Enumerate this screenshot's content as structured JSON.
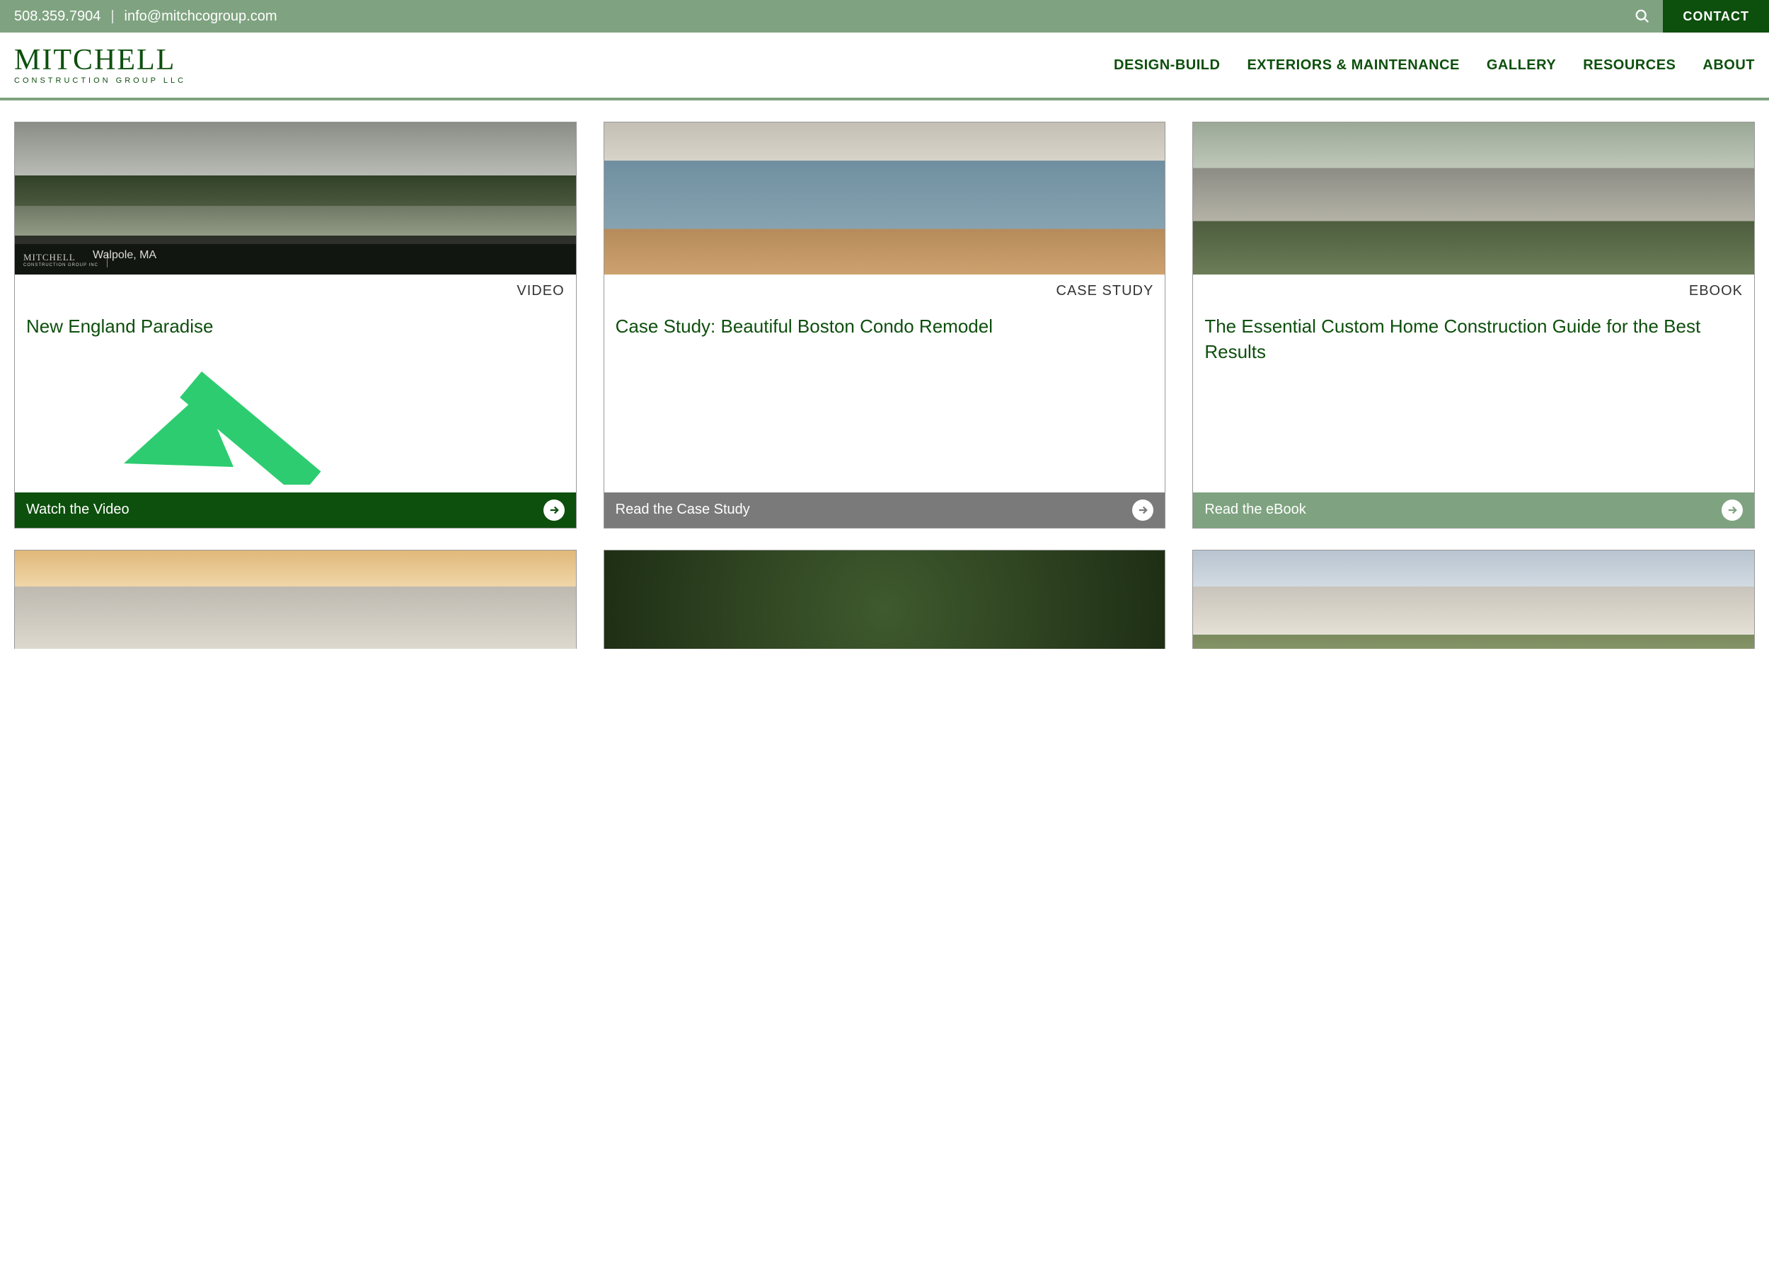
{
  "topbar": {
    "phone": "508.359.7904",
    "email": "info@mitchcogroup.com",
    "contact": "CONTACT"
  },
  "logo": {
    "main": "MITCHELL",
    "sub": "CONSTRUCTION GROUP LLC"
  },
  "nav": {
    "items": [
      "DESIGN-BUILD",
      "EXTERIORS & MAINTENANCE",
      "GALLERY",
      "RESOURCES",
      "ABOUT"
    ]
  },
  "cards": [
    {
      "tag": "VIDEO",
      "title": "New England Paradise",
      "cta": "Watch the Video",
      "caption": "Walpole, MA",
      "logocap": "MITCHELL",
      "logosub": "CONSTRUCTION GROUP INC"
    },
    {
      "tag": "CASE STUDY",
      "title": "Case Study: Beautiful Boston Condo Remodel",
      "cta": "Read the Case Study"
    },
    {
      "tag": "EBOOK",
      "title": "The Essential Custom Home Construction Guide for the Best Results",
      "cta": "Read the eBook"
    }
  ]
}
